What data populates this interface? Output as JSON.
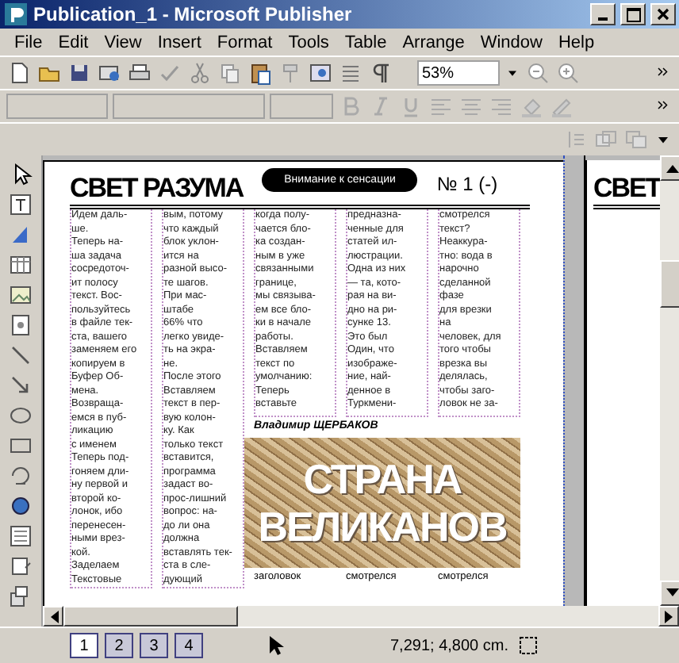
{
  "window": {
    "title": "Publication_1 - Microsoft Publisher"
  },
  "menu": [
    "File",
    "Edit",
    "View",
    "Insert",
    "Format",
    "Tools",
    "Table",
    "Arrange",
    "Window",
    "Help"
  ],
  "toolbar": {
    "zoom": "53%"
  },
  "publication": {
    "masthead": "СВЕТ РАЗУМА",
    "banner": "Внимание к сенсации",
    "issue": "№ 1 (-)",
    "columns": [
      {
        "lines": [
          "Идем даль-",
          "ше.",
          "Теперь на-",
          "ша задача",
          "сосредоточ-",
          "ит полосу",
          "текст. Вос-",
          "пользуйтесь",
          "в файле тек-",
          "ста, вашего",
          "заменяем его",
          "копируем в",
          "Буфер Об-",
          "мена.",
          "Возвраща-",
          "емся в пуб-",
          "ликацию",
          "с именем",
          "Теперь под-",
          "гоняем дли-",
          "ну первой и",
          "второй ко-",
          "лонок, ибо",
          "перенесен-",
          "ными врез-",
          "кой.",
          "Заделаем",
          "Текстовые"
        ]
      },
      {
        "lines": [
          "вым, потому",
          "что каждый",
          "блок уклон-",
          "ится на",
          "разной высо-",
          "те шагов.",
          "При мас-",
          "штабе",
          "66% что",
          "легко увиде-",
          "ть на экра-",
          "не.",
          "После этого",
          "Вставляем",
          "текст в пер-",
          "вую колон-",
          "ку. Как",
          "только текст",
          "вставится,",
          "программа",
          "задаст во-",
          "прос-лишний",
          "вопрос: на-",
          "до ли она",
          "должна",
          "вставлять тек-",
          "ста в сле-",
          "дующий"
        ]
      },
      {
        "lines": [
          "когда полу-",
          "чается бло-",
          "ка создан-",
          "ным в уже",
          "связанными",
          "границе,",
          "мы связыва-",
          "ем все бло-",
          "ки в начале",
          "работы.",
          "Вставляем",
          "текст по",
          "умолчанию:",
          "Теперь",
          "вставьте"
        ]
      },
      {
        "lines": [
          "предназна-",
          "ченные для",
          "статей ил-",
          "люстрации.",
          "Одна из них",
          "— та, кото-",
          "рая на ви-",
          "дно на ри-",
          "сунке 13.",
          "Это был",
          "Один, что",
          "изображе-",
          "ние, най-",
          "денное в",
          "Туркмени-"
        ]
      },
      {
        "lines": [
          "смотрелся",
          "текст?",
          "Неаккура-",
          "тно: вода в",
          "нарочно",
          "сделанной",
          "фазе",
          "для врезки",
          "на",
          "человек, для",
          "того чтобы",
          "врезка вы",
          "делялась,",
          "чтобы заго-",
          "ловок не за-"
        ]
      }
    ],
    "byline": "Владимир ЩЕРБАКОВ",
    "headline": [
      "СТРАНА",
      "ВЕЛИКАНОВ"
    ],
    "continued": [
      "заголовок",
      "смотрелся",
      "смотрелся"
    ],
    "next_page_masthead": "СВЕТ"
  },
  "page_tabs": [
    {
      "label": "1",
      "selected": true
    },
    {
      "label": "2",
      "selected": false
    },
    {
      "label": "3",
      "selected": false
    },
    {
      "label": "4",
      "selected": false
    }
  ],
  "status": {
    "position": "7,291; 4,800 cm."
  }
}
